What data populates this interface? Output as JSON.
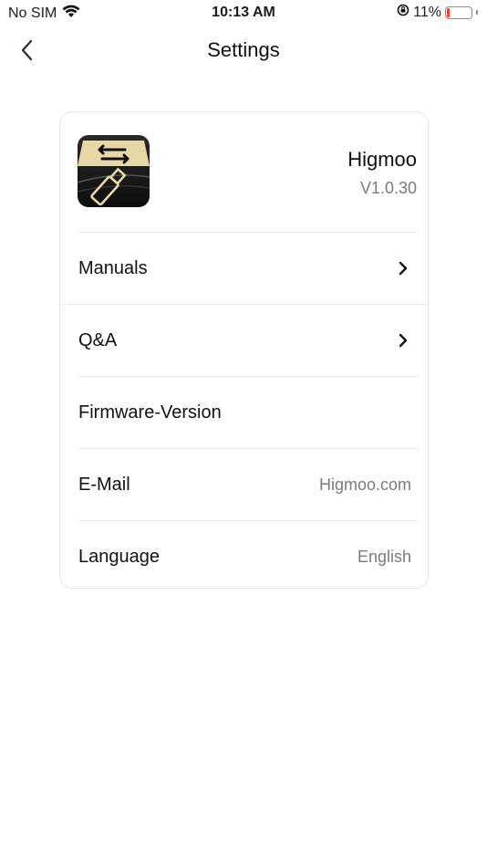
{
  "status_bar": {
    "carrier": "No SIM",
    "time": "10:13 AM",
    "battery_percent": "11%",
    "battery_level": 0.11
  },
  "nav": {
    "title": "Settings"
  },
  "app": {
    "name": "Higmoo",
    "version": "V1.0.30"
  },
  "rows": [
    {
      "label": "Manuals",
      "value": "",
      "has_chevron": true
    },
    {
      "label": "Q&A",
      "value": "",
      "has_chevron": true
    },
    {
      "label": "Firmware-Version",
      "value": "",
      "has_chevron": false
    },
    {
      "label": "E-Mail",
      "value": "Higmoo.com",
      "has_chevron": false
    },
    {
      "label": "Language",
      "value": "English",
      "has_chevron": false
    }
  ],
  "colors": {
    "battery_low": "#ff3b30",
    "secondary_text": "#7a7a7f",
    "icon_gold": "#e8d8a8"
  }
}
